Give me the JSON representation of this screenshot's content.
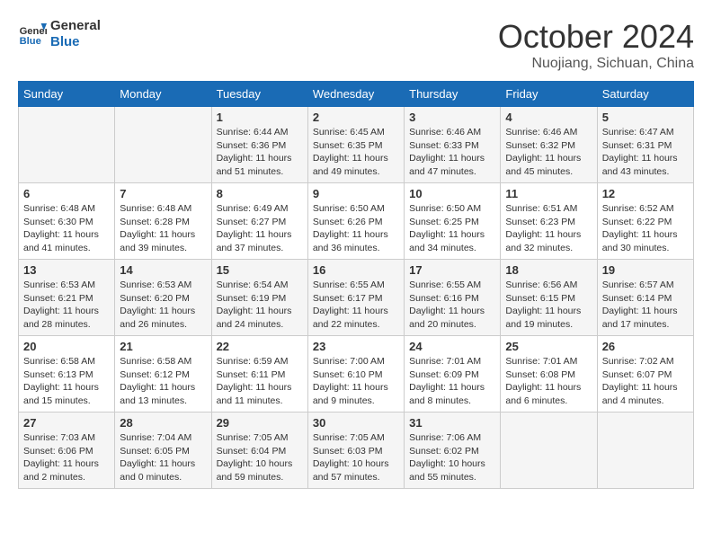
{
  "header": {
    "logo_line1": "General",
    "logo_line2": "Blue",
    "month": "October 2024",
    "location": "Nuojiang, Sichuan, China"
  },
  "days_of_week": [
    "Sunday",
    "Monday",
    "Tuesday",
    "Wednesday",
    "Thursday",
    "Friday",
    "Saturday"
  ],
  "weeks": [
    [
      {
        "day": "",
        "info": ""
      },
      {
        "day": "",
        "info": ""
      },
      {
        "day": "1",
        "info": "Sunrise: 6:44 AM\nSunset: 6:36 PM\nDaylight: 11 hours and 51 minutes."
      },
      {
        "day": "2",
        "info": "Sunrise: 6:45 AM\nSunset: 6:35 PM\nDaylight: 11 hours and 49 minutes."
      },
      {
        "day": "3",
        "info": "Sunrise: 6:46 AM\nSunset: 6:33 PM\nDaylight: 11 hours and 47 minutes."
      },
      {
        "day": "4",
        "info": "Sunrise: 6:46 AM\nSunset: 6:32 PM\nDaylight: 11 hours and 45 minutes."
      },
      {
        "day": "5",
        "info": "Sunrise: 6:47 AM\nSunset: 6:31 PM\nDaylight: 11 hours and 43 minutes."
      }
    ],
    [
      {
        "day": "6",
        "info": "Sunrise: 6:48 AM\nSunset: 6:30 PM\nDaylight: 11 hours and 41 minutes."
      },
      {
        "day": "7",
        "info": "Sunrise: 6:48 AM\nSunset: 6:28 PM\nDaylight: 11 hours and 39 minutes."
      },
      {
        "day": "8",
        "info": "Sunrise: 6:49 AM\nSunset: 6:27 PM\nDaylight: 11 hours and 37 minutes."
      },
      {
        "day": "9",
        "info": "Sunrise: 6:50 AM\nSunset: 6:26 PM\nDaylight: 11 hours and 36 minutes."
      },
      {
        "day": "10",
        "info": "Sunrise: 6:50 AM\nSunset: 6:25 PM\nDaylight: 11 hours and 34 minutes."
      },
      {
        "day": "11",
        "info": "Sunrise: 6:51 AM\nSunset: 6:23 PM\nDaylight: 11 hours and 32 minutes."
      },
      {
        "day": "12",
        "info": "Sunrise: 6:52 AM\nSunset: 6:22 PM\nDaylight: 11 hours and 30 minutes."
      }
    ],
    [
      {
        "day": "13",
        "info": "Sunrise: 6:53 AM\nSunset: 6:21 PM\nDaylight: 11 hours and 28 minutes."
      },
      {
        "day": "14",
        "info": "Sunrise: 6:53 AM\nSunset: 6:20 PM\nDaylight: 11 hours and 26 minutes."
      },
      {
        "day": "15",
        "info": "Sunrise: 6:54 AM\nSunset: 6:19 PM\nDaylight: 11 hours and 24 minutes."
      },
      {
        "day": "16",
        "info": "Sunrise: 6:55 AM\nSunset: 6:17 PM\nDaylight: 11 hours and 22 minutes."
      },
      {
        "day": "17",
        "info": "Sunrise: 6:55 AM\nSunset: 6:16 PM\nDaylight: 11 hours and 20 minutes."
      },
      {
        "day": "18",
        "info": "Sunrise: 6:56 AM\nSunset: 6:15 PM\nDaylight: 11 hours and 19 minutes."
      },
      {
        "day": "19",
        "info": "Sunrise: 6:57 AM\nSunset: 6:14 PM\nDaylight: 11 hours and 17 minutes."
      }
    ],
    [
      {
        "day": "20",
        "info": "Sunrise: 6:58 AM\nSunset: 6:13 PM\nDaylight: 11 hours and 15 minutes."
      },
      {
        "day": "21",
        "info": "Sunrise: 6:58 AM\nSunset: 6:12 PM\nDaylight: 11 hours and 13 minutes."
      },
      {
        "day": "22",
        "info": "Sunrise: 6:59 AM\nSunset: 6:11 PM\nDaylight: 11 hours and 11 minutes."
      },
      {
        "day": "23",
        "info": "Sunrise: 7:00 AM\nSunset: 6:10 PM\nDaylight: 11 hours and 9 minutes."
      },
      {
        "day": "24",
        "info": "Sunrise: 7:01 AM\nSunset: 6:09 PM\nDaylight: 11 hours and 8 minutes."
      },
      {
        "day": "25",
        "info": "Sunrise: 7:01 AM\nSunset: 6:08 PM\nDaylight: 11 hours and 6 minutes."
      },
      {
        "day": "26",
        "info": "Sunrise: 7:02 AM\nSunset: 6:07 PM\nDaylight: 11 hours and 4 minutes."
      }
    ],
    [
      {
        "day": "27",
        "info": "Sunrise: 7:03 AM\nSunset: 6:06 PM\nDaylight: 11 hours and 2 minutes."
      },
      {
        "day": "28",
        "info": "Sunrise: 7:04 AM\nSunset: 6:05 PM\nDaylight: 11 hours and 0 minutes."
      },
      {
        "day": "29",
        "info": "Sunrise: 7:05 AM\nSunset: 6:04 PM\nDaylight: 10 hours and 59 minutes."
      },
      {
        "day": "30",
        "info": "Sunrise: 7:05 AM\nSunset: 6:03 PM\nDaylight: 10 hours and 57 minutes."
      },
      {
        "day": "31",
        "info": "Sunrise: 7:06 AM\nSunset: 6:02 PM\nDaylight: 10 hours and 55 minutes."
      },
      {
        "day": "",
        "info": ""
      },
      {
        "day": "",
        "info": ""
      }
    ]
  ]
}
